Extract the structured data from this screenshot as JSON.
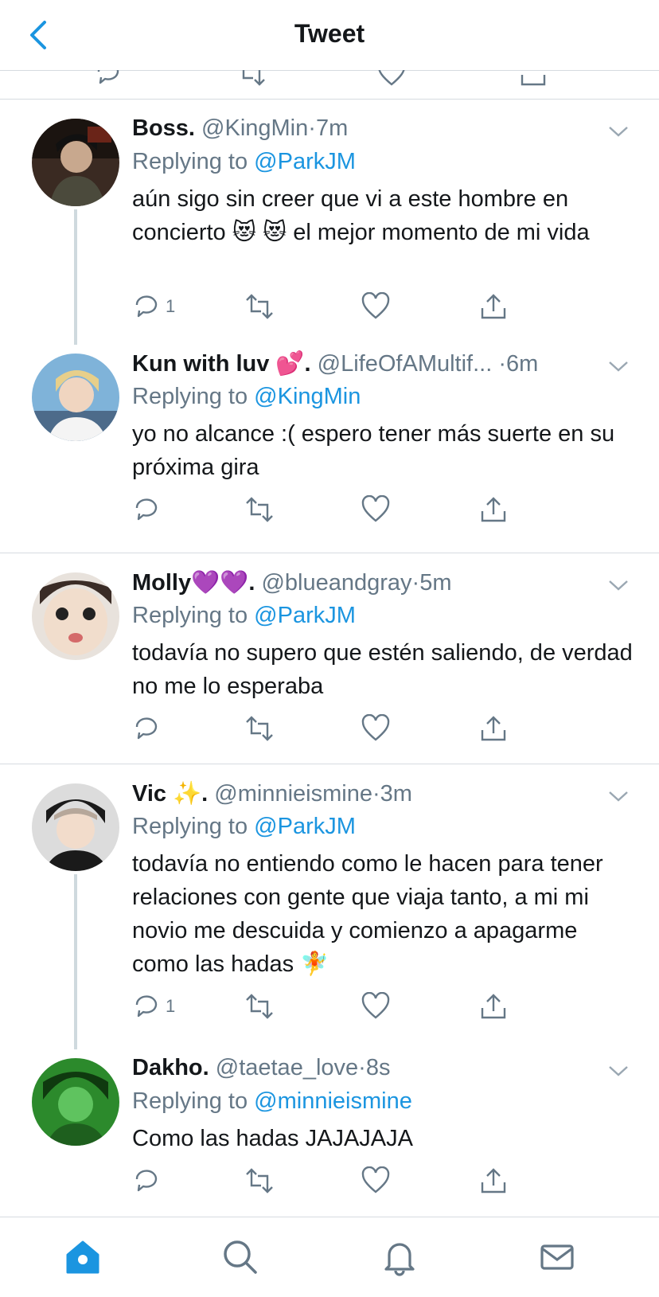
{
  "header": {
    "title": "Tweet"
  },
  "colors": {
    "accent": "#1b95e0",
    "muted": "#657786",
    "divider": "#d6dbe0"
  },
  "tweets": [
    {
      "name": "Boss.",
      "handle": "@KingMin",
      "dot": "·",
      "time": "7m",
      "replying_label": "Replying to",
      "replying_to": "@ParkJM",
      "text": "aún sigo sin creer que vi a este hombre en concierto 😻 😻 el mejor momento de mi vida",
      "reply_count": "1"
    },
    {
      "name": "Kun with luv 💕.",
      "handle": "@LifeOfAMultif...",
      "dot": "·",
      "time": "6m",
      "replying_label": "Replying to",
      "replying_to": "@KingMin",
      "text": "yo no alcance :( espero tener más suerte en su próxima gira",
      "reply_count": ""
    },
    {
      "name": "Molly💜💜.",
      "handle": "@blueandgray",
      "dot": "·",
      "time": "5m",
      "replying_label": "Replying to",
      "replying_to": "@ParkJM",
      "text": "todavía no supero que estén saliendo, de verdad no me lo esperaba",
      "reply_count": ""
    },
    {
      "name": "Vic ✨.",
      "handle": "@minnieismine",
      "dot": "·",
      "time": "3m",
      "replying_label": "Replying to",
      "replying_to": "@ParkJM",
      "text": "todavía no entiendo como le hacen para tener relaciones con gente que viaja tanto, a mi mi novio me descuida y comienzo a apagarme como las hadas 🧚",
      "reply_count": "1"
    },
    {
      "name": "Dakho.",
      "handle": "@taetae_love",
      "dot": "·",
      "time": "8s",
      "replying_label": "Replying to",
      "replying_to": "@minnieismine",
      "text": "Como las hadas JAJAJAJA",
      "reply_count": ""
    }
  ],
  "tabbar": {
    "icons": [
      "home-icon",
      "search-icon",
      "bell-icon",
      "mail-icon"
    ]
  }
}
